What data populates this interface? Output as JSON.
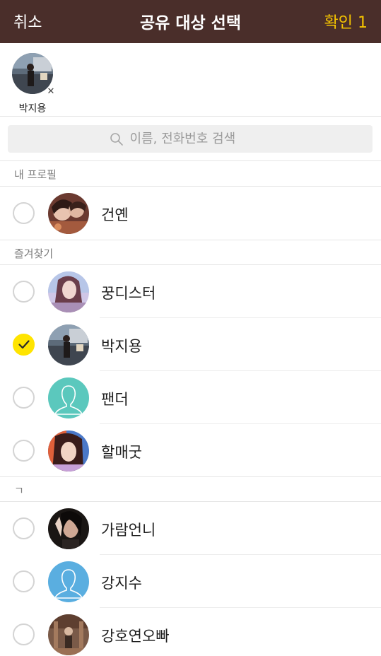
{
  "header": {
    "cancel_label": "취소",
    "title": "공유 대상 선택",
    "confirm_label": "확인 1",
    "bg_color": "#4a2e2a",
    "confirm_color": "#f5c400"
  },
  "selected": {
    "items": [
      {
        "name": "박지용",
        "remove_icon": "close-icon"
      }
    ]
  },
  "search": {
    "placeholder": "이름, 전화번호 검색",
    "icon": "search-icon"
  },
  "sections": {
    "my_profile": "내 프로필",
    "favorites": "즐겨찾기",
    "giyeok": "ㄱ"
  },
  "contacts": {
    "my_profile": [
      {
        "name": "건옌",
        "checked": false,
        "avatar": "photo"
      }
    ],
    "favorites": [
      {
        "name": "꿍디스터",
        "checked": false,
        "avatar": "photo"
      },
      {
        "name": "박지용",
        "checked": true,
        "avatar": "photo"
      },
      {
        "name": "팬더",
        "checked": false,
        "avatar": "default-teal"
      },
      {
        "name": "할매굿",
        "checked": false,
        "avatar": "photo"
      }
    ],
    "giyeok": [
      {
        "name": "가람언니",
        "checked": false,
        "avatar": "photo"
      },
      {
        "name": "강지수",
        "checked": false,
        "avatar": "default-blue"
      },
      {
        "name": "강호연오빠",
        "checked": false,
        "avatar": "photo"
      }
    ]
  },
  "colors": {
    "check_on": "#ffe400",
    "default_avatar_teal": "#5bc8bd",
    "default_avatar_blue": "#5aaee0"
  }
}
